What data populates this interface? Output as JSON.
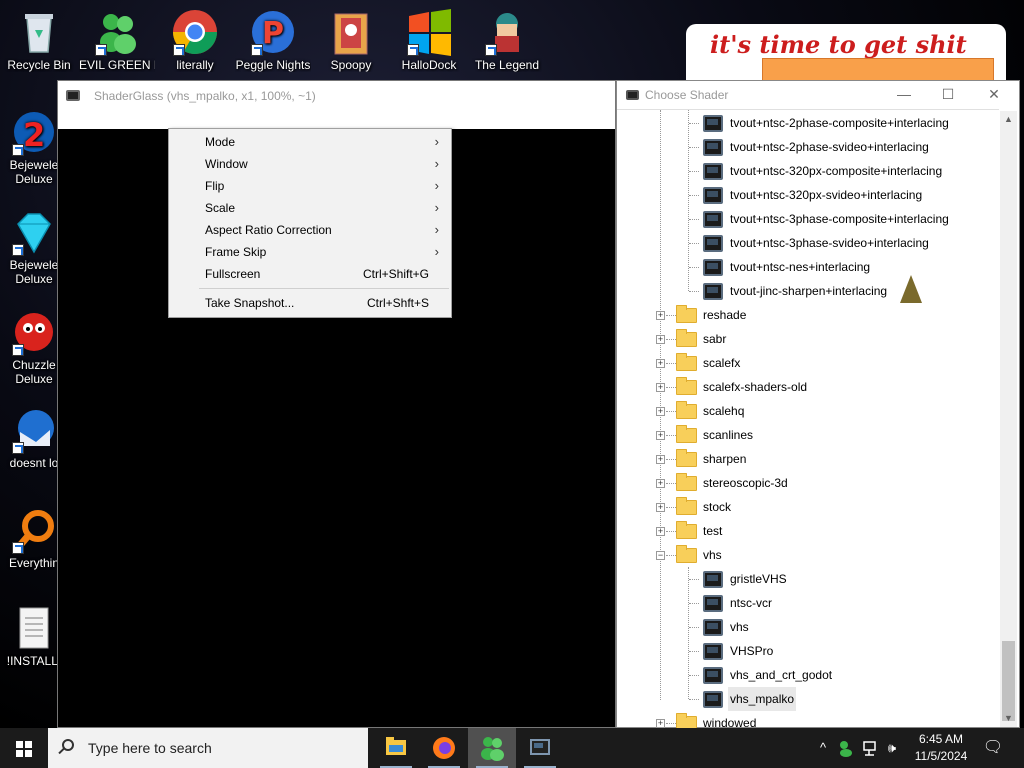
{
  "desktop": {
    "icons": [
      {
        "label": "Recycle Bin",
        "icon": "recycle-bin-icon"
      },
      {
        "label": "EVIL GREEN MEN CO",
        "icon": "green-men-icon"
      },
      {
        "label": "literally",
        "icon": "chrome-icon"
      },
      {
        "label": "Peggle Nights",
        "icon": "peggle-icon"
      },
      {
        "label": "Spoopy",
        "icon": "folder-icon"
      },
      {
        "label": "HalloDock",
        "icon": "windows-logo-icon"
      },
      {
        "label": "The Legend",
        "icon": "zelda-character-icon"
      },
      {
        "label": "Bejewele Deluxe",
        "icon": "bejeweled-2-icon"
      },
      {
        "label": "Bejewele Deluxe",
        "icon": "diamond-icon"
      },
      {
        "label": "Chuzzle Deluxe",
        "icon": "chuzzle-icon"
      },
      {
        "label": "doesnt lo",
        "icon": "thunderbird-icon"
      },
      {
        "label": "Everythin",
        "icon": "everything-search-icon"
      },
      {
        "label": "!INSTALLI",
        "icon": "text-file-icon"
      }
    ],
    "banner_text": "it's time to get shit"
  },
  "shaderglass": {
    "title": "ShaderGlass (vhs_mpalko, x1, 100%, ~1)"
  },
  "context_menu": {
    "items": [
      {
        "label": "Mode",
        "shortcut": "",
        "submenu": "›"
      },
      {
        "label": "Window",
        "shortcut": "",
        "submenu": "›"
      },
      {
        "label": "Flip",
        "shortcut": "",
        "submenu": "›"
      },
      {
        "label": "Scale",
        "shortcut": "",
        "submenu": "›"
      },
      {
        "label": "Aspect Ratio Correction",
        "shortcut": "",
        "submenu": "›"
      },
      {
        "label": "Frame Skip",
        "shortcut": "",
        "submenu": "›"
      },
      {
        "label": "Fullscreen",
        "shortcut": "Ctrl+Shift+G",
        "submenu": ""
      }
    ],
    "snapshot": {
      "label": "Take Snapshot...",
      "shortcut": "Ctrl+Shft+S"
    }
  },
  "choose_shader": {
    "title": "Choose Shader",
    "min": "—",
    "max": "☐",
    "close": "✕",
    "shaders_top": [
      "tvout+ntsc-2phase-composite+interlacing",
      "tvout+ntsc-2phase-svideo+interlacing",
      "tvout+ntsc-320px-composite+interlacing",
      "tvout+ntsc-320px-svideo+interlacing",
      "tvout+ntsc-3phase-composite+interlacing",
      "tvout+ntsc-3phase-svideo+interlacing",
      "tvout+ntsc-nes+interlacing",
      "tvout-jinc-sharpen+interlacing"
    ],
    "folders": [
      "reshade",
      "sabr",
      "scalefx",
      "scalefx-shaders-old",
      "scalehq",
      "scanlines",
      "sharpen",
      "stereoscopic-3d",
      "stock",
      "test"
    ],
    "open_folder": "vhs",
    "vhs_shaders": [
      "gristleVHS",
      "ntsc-vcr",
      "vhs",
      "VHSPro",
      "vhs_and_crt_godot",
      "vhs_mpalko"
    ],
    "last_folder": "windowed",
    "expand_plus": "+",
    "expand_minus": "−"
  },
  "taskbar": {
    "search_placeholder": "Type here to search",
    "time": "6:45 AM",
    "date": "11/5/2024",
    "tray": {
      "chevron": "^",
      "volume": "🕪",
      "notification": "🗨"
    }
  }
}
